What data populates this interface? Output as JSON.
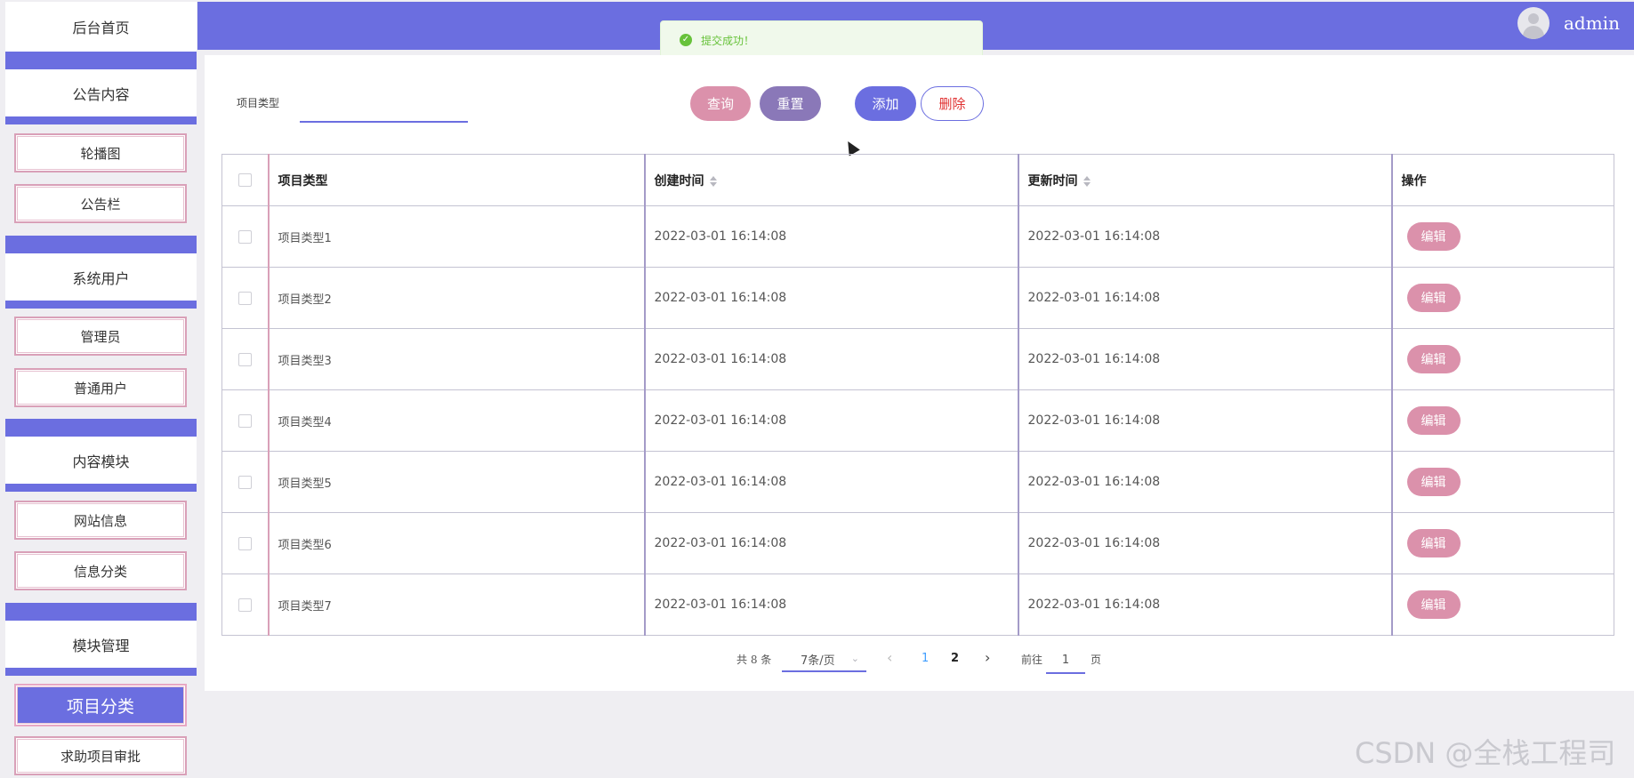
{
  "sidebar": {
    "home": "后台首页",
    "groups": [
      {
        "title": "公告内容",
        "items": [
          "轮播图",
          "公告栏"
        ]
      },
      {
        "title": "系统用户",
        "items": [
          "管理员",
          "普通用户"
        ]
      },
      {
        "title": "内容模块",
        "items": [
          "网站信息",
          "信息分类"
        ]
      },
      {
        "title": "模块管理",
        "items": [
          "项目分类",
          "求助项目审批"
        ]
      }
    ],
    "active_item": "项目分类"
  },
  "header": {
    "username": "admin"
  },
  "toast": {
    "message": "提交成功！"
  },
  "search": {
    "label": "项目类型",
    "placeholder": ""
  },
  "buttons": {
    "query": "查询",
    "reset": "重置",
    "add": "添加",
    "delete": "删除"
  },
  "table": {
    "columns": [
      "项目类型",
      "创建时间",
      "更新时间",
      "操作"
    ],
    "edit_label": "编辑",
    "rows": [
      {
        "type": "项目类型1",
        "created": "2022-03-01 16:14:08",
        "updated": "2022-03-01 16:14:08"
      },
      {
        "type": "项目类型2",
        "created": "2022-03-01 16:14:08",
        "updated": "2022-03-01 16:14:08"
      },
      {
        "type": "项目类型3",
        "created": "2022-03-01 16:14:08",
        "updated": "2022-03-01 16:14:08"
      },
      {
        "type": "项目类型4",
        "created": "2022-03-01 16:14:08",
        "updated": "2022-03-01 16:14:08"
      },
      {
        "type": "项目类型5",
        "created": "2022-03-01 16:14:08",
        "updated": "2022-03-01 16:14:08"
      },
      {
        "type": "项目类型6",
        "created": "2022-03-01 16:14:08",
        "updated": "2022-03-01 16:14:08"
      },
      {
        "type": "项目类型7",
        "created": "2022-03-01 16:14:08",
        "updated": "2022-03-01 16:14:08"
      }
    ]
  },
  "pagination": {
    "total": "共 8 条",
    "page_size": "7条/页",
    "pages": [
      "1",
      "2"
    ],
    "current_page": "1",
    "goto_label": "前往",
    "goto_value": "1",
    "page_suffix": "页"
  },
  "watermark": "CSDN @全栈工程司",
  "colors": {
    "primary": "#6b6ee0",
    "pink": "#db91ab",
    "purple": "#8a78b8",
    "success": "#67c23a"
  }
}
